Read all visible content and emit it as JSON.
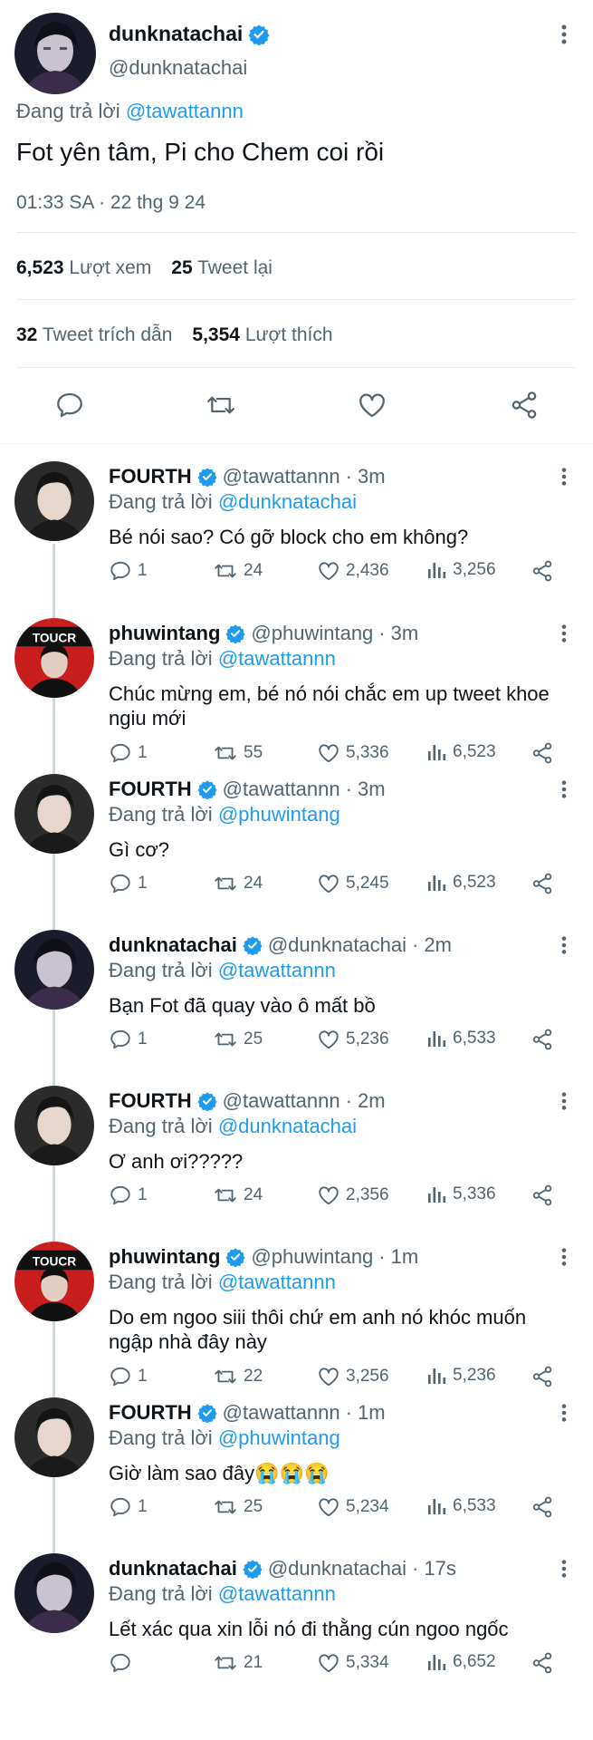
{
  "colors": {
    "accent": "#1d9bf0",
    "text": "#0f1419",
    "muted": "#536471",
    "verified": "#1d9bf0"
  },
  "main_tweet": {
    "name": "dunknatachai",
    "handle": "@dunknatachai",
    "reply_prefix": "Đang trả lời",
    "reply_to": "@tawattannn",
    "text": "Fot yên tâm, Pi cho Chem coi rồi",
    "timestamp": "01:33 SA · 22 thg 9 24",
    "views_count": "6,523",
    "views_label": "Lượt xem",
    "retweets_count": "25",
    "retweets_label": "Tweet lại",
    "quotes_count": "32",
    "quotes_label": "Tweet trích dẫn",
    "likes_count": "5,354",
    "likes_label": "Lượt thích"
  },
  "replies": [
    {
      "name": "FOURTH",
      "handle": "@tawattannn",
      "time": "3m",
      "reply_prefix": "Đang trả lời",
      "reply_to": "@dunknatachai",
      "text": "Bé nói sao? Có gỡ block cho em không?",
      "replies": "1",
      "retweets": "24",
      "likes": "2,436",
      "views": "3,256"
    },
    {
      "name": "phuwintang",
      "handle": "@phuwintang",
      "time": "3m",
      "reply_prefix": "Đang trả lời",
      "reply_to": "@tawattannn",
      "text": "Chúc mừng em, bé nó nói chắc em up tweet khoe ngiu mới",
      "replies": "1",
      "retweets": "55",
      "likes": "5,336",
      "views": "6,523"
    },
    {
      "name": "FOURTH",
      "handle": "@tawattannn",
      "time": "3m",
      "reply_prefix": "Đang trả lời",
      "reply_to": "@phuwintang",
      "text": "Gì cơ?",
      "replies": "1",
      "retweets": "24",
      "likes": "5,245",
      "views": "6,523"
    },
    {
      "name": "dunknatachai",
      "handle": "@dunknatachai",
      "time": "2m",
      "reply_prefix": "Đang trả lời",
      "reply_to": "@tawattannn",
      "text": "Bạn Fot đã quay vào ô mất bồ",
      "replies": "1",
      "retweets": "25",
      "likes": "5,236",
      "views": "6,533"
    },
    {
      "name": "FOURTH",
      "handle": "@tawattannn",
      "time": "2m",
      "reply_prefix": "Đang trả lời",
      "reply_to": "@dunknatachai",
      "text": "Ơ anh ơi?????",
      "replies": "1",
      "retweets": "24",
      "likes": "2,356",
      "views": "5,336"
    },
    {
      "name": "phuwintang",
      "handle": "@phuwintang",
      "time": "1m",
      "reply_prefix": "Đang trả lời",
      "reply_to": "@tawattannn",
      "text": "Do em ngoo siii thôi chứ em anh nó khóc muốn ngập nhà đây này",
      "replies": "1",
      "retweets": "22",
      "likes": "3,256",
      "views": "5,236"
    },
    {
      "name": "FOURTH",
      "handle": "@tawattannn",
      "time": "1m",
      "reply_prefix": "Đang trả lời",
      "reply_to": "@phuwintang",
      "text": "Giờ làm sao đây😭😭😭",
      "replies": "1",
      "retweets": "25",
      "likes": "5,234",
      "views": "6,533"
    },
    {
      "name": "dunknatachai",
      "handle": "@dunknatachai",
      "time": "17s",
      "reply_prefix": "Đang trả lời",
      "reply_to": "@tawattannn",
      "text": "Lết xác qua xin lỗi nó đi thằng cún ngoo ngốc",
      "replies": "",
      "retweets": "21",
      "likes": "5,334",
      "views": "6,652"
    }
  ],
  "icons": {
    "verified": "verified-badge-icon",
    "more": "more-vertical-icon",
    "reply": "reply-icon",
    "retweet": "retweet-icon",
    "like": "heart-icon",
    "views": "views-chart-icon",
    "share": "share-icon"
  }
}
